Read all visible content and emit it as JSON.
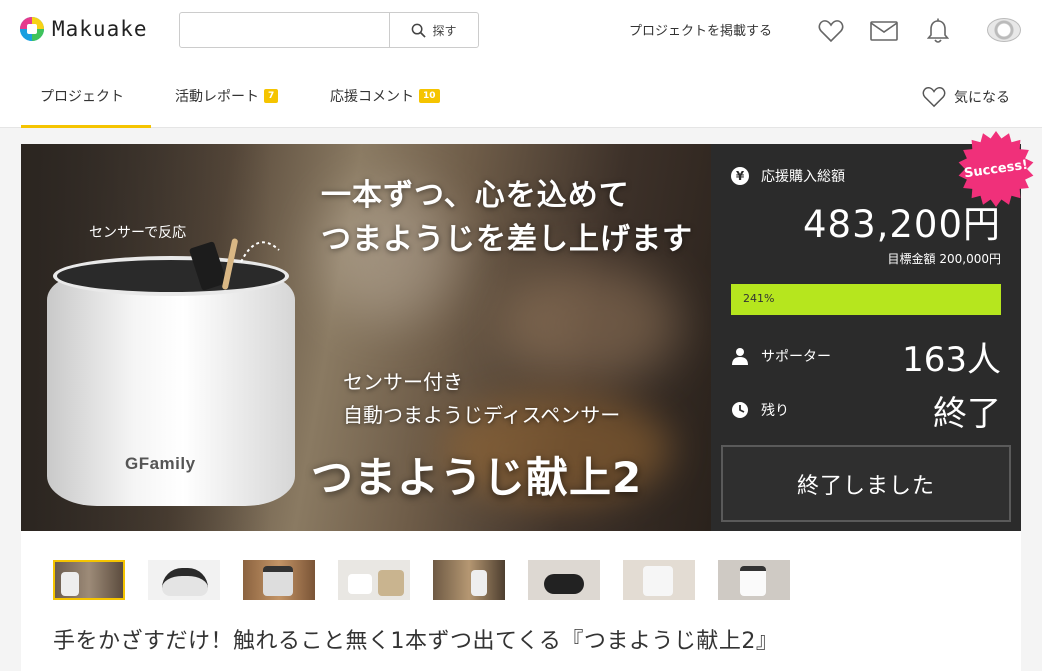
{
  "header": {
    "logo_text": "Makuake",
    "search": {
      "placeholder": "",
      "button_label": "探す"
    },
    "post_project": "プロジェクトを掲載する",
    "icons": [
      "heart-icon",
      "mail-icon",
      "bell-icon",
      "user-avatar"
    ]
  },
  "tabs": [
    {
      "label": "プロジェクト",
      "badge": ""
    },
    {
      "label": "活動レポート",
      "badge": "7"
    },
    {
      "label": "応援コメント",
      "badge": "10"
    }
  ],
  "favorite_label": "気になる",
  "hero": {
    "sensor_label": "センサーで反応",
    "title_line1": "一本ずつ、心を込めて",
    "title_line2": "つまようじを差し上げます",
    "sub_line1": "センサー付き",
    "sub_line2": "自動つまようじディスペンサー",
    "product_name": "つまようじ献上2",
    "brand": "GFamily"
  },
  "stats": {
    "total_label": "応援購入総額",
    "total_amount": "483,200円",
    "goal_text": "目標金額 200,000円",
    "progress_text": "241%",
    "progress_percent": 241,
    "supporters_label": "サポーター",
    "supporters_value": "163人",
    "remaining_label": "残り",
    "remaining_value": "終了",
    "button_label": "終了しました",
    "success_badge": "Success!",
    "accent_color": "#b6e61e",
    "badge_color": "#f0307a"
  },
  "thumbnails_count": 8,
  "project_title": "手をかざすだけ！触れること無く1本ずつ出てくる『つまようじ献上2』"
}
